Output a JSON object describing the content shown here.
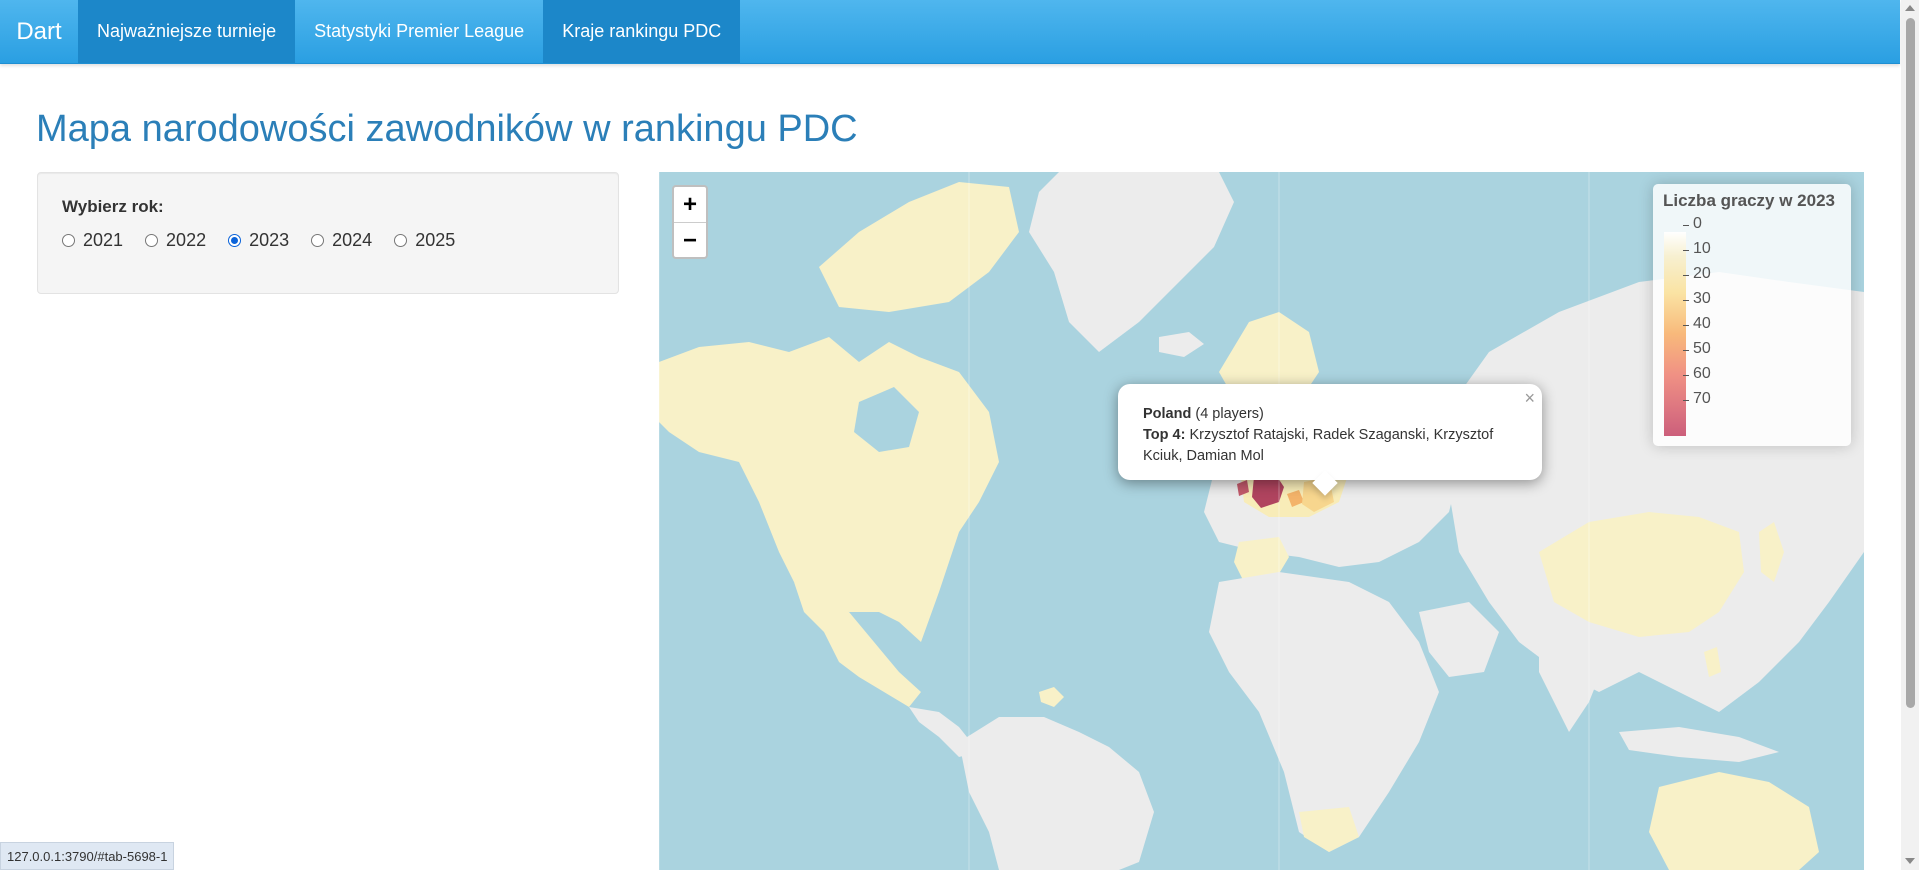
{
  "navbar": {
    "brand": "Dart",
    "tabs": [
      {
        "label": "Najważniejsze turnieje",
        "active": true
      },
      {
        "label": "Statystyki Premier League",
        "active": false
      },
      {
        "label": "Kraje rankingu PDC",
        "active": true
      }
    ]
  },
  "page": {
    "title": "Mapa narodowości zawodników w rankingu PDC"
  },
  "sidebar": {
    "label": "Wybierz rok:",
    "years": [
      "2021",
      "2022",
      "2023",
      "2024",
      "2025"
    ],
    "selected": "2023"
  },
  "map": {
    "zoom_in": "+",
    "zoom_out": "−",
    "popup": {
      "country": "Poland",
      "players": "(4 players)",
      "top_label": "Top 4:",
      "top_players": "Krzysztof Ratajski, Radek Szaganski, Krzysztof Kciuk, Damian Mol",
      "close": "×"
    },
    "legend": {
      "title": "Liczba graczy w 2023",
      "labels": [
        "0",
        "10",
        "20",
        "30",
        "40",
        "50",
        "60",
        "70"
      ]
    },
    "colors": {
      "ocean": "#aad3df",
      "land_no_data": "#ececec",
      "low": "#f8f1c8",
      "mid": "#f3b36a",
      "high": "#b0445f"
    }
  },
  "statusbar": {
    "url": "127.0.0.1:3790/#tab-5698-1"
  }
}
